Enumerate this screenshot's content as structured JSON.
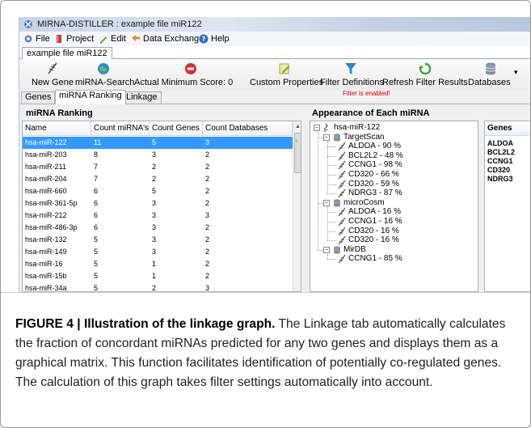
{
  "window": {
    "title": "MIRNA-DISTILLER : example file miR122",
    "icon": "app-dna-icon"
  },
  "menu": [
    {
      "label": "File",
      "icon": "gear-icon"
    },
    {
      "label": "Project",
      "icon": "book-icon"
    },
    {
      "label": "Edit",
      "icon": "pencil-icon"
    },
    {
      "label": "Data Exchange",
      "icon": "transfer-icon"
    },
    {
      "label": "Help",
      "icon": "help-icon"
    }
  ],
  "document_tab": "example file miR122",
  "toolbar": [
    {
      "label": "New Gene",
      "icon": "gene-icon"
    },
    {
      "label": "miRNA-Search",
      "icon": "globe-icon"
    },
    {
      "label": "Actual Minimum Score: 0",
      "icon": "stop-icon"
    },
    {
      "label": "Custom Properties",
      "icon": "edit-note-icon"
    },
    {
      "label": "Filter Definitions",
      "icon": "funnel-icon"
    },
    {
      "label": "Refresh Filter Results",
      "icon": "refresh-icon"
    },
    {
      "label": "Databases",
      "icon": "database-icon"
    }
  ],
  "toolbar_overflow": "▾",
  "filter_status": "Filter is enabled!",
  "view_tabs": [
    "Genes",
    "miRNA Ranking",
    "Linkage"
  ],
  "active_view_tab": "miRNA Ranking",
  "ranking": {
    "title": "miRNA Ranking",
    "columns": [
      "Name",
      "Count miRNA's",
      "Count Genes",
      "Count Databases"
    ],
    "rows": [
      [
        "hsa-miR-122",
        "11",
        "5",
        "3"
      ],
      [
        "hsa-miR-203",
        "8",
        "3",
        "2"
      ],
      [
        "hsa-miR-211",
        "7",
        "2",
        "2"
      ],
      [
        "hsa-miR-204",
        "7",
        "2",
        "2"
      ],
      [
        "hsa-miR-660",
        "6",
        "5",
        "2"
      ],
      [
        "hsa-miR-361-5p",
        "6",
        "3",
        "2"
      ],
      [
        "hsa-miR-212",
        "6",
        "3",
        "3"
      ],
      [
        "hsa-miR-486-3p",
        "6",
        "3",
        "2"
      ],
      [
        "hsa-miR-132",
        "5",
        "3",
        "2"
      ],
      [
        "hsa-miR-149",
        "5",
        "3",
        "2"
      ],
      [
        "hsa-miR-16",
        "5",
        "1",
        "2"
      ],
      [
        "hsa-miR-15b",
        "5",
        "1",
        "2"
      ],
      [
        "hsa-miR-34a",
        "5",
        "2",
        "3"
      ]
    ],
    "selected_row": 0
  },
  "appearance": {
    "title": "Appearance of Each miRNA",
    "root": "hsa-miR-122",
    "databases": [
      {
        "name": "TargetScan",
        "targets": [
          "ALDOA - 90 %",
          "BCL2L2 - 48 %",
          "CCNG1 - 98 %",
          "CD320 - 66 %",
          "CD320 - 59 %",
          "NDRG3 - 87 %"
        ]
      },
      {
        "name": "microCosm",
        "targets": [
          "ALDOA - 16 %",
          "CCNG1 - 16 %",
          "CD320 - 16 %",
          "CD320 - 16 %"
        ]
      },
      {
        "name": "MirDB",
        "targets": [
          "CCNG1 - 85 %"
        ]
      }
    ]
  },
  "genes_panel": {
    "header": "Genes",
    "items": [
      "ALDOA",
      "BCL2L2",
      "CCNG1",
      "CD320",
      "NDRG3"
    ]
  },
  "caption": {
    "lead": "FIGURE 4 | Illustration of the linkage graph.",
    "body": " The Linkage tab automatically calculates the fraction of concordant miRNAs predicted for any two genes and displays them as a graphical matrix. This function facilitates identification of potentially co-regulated genes. The calculation of this graph takes filter settings automatically into account."
  }
}
